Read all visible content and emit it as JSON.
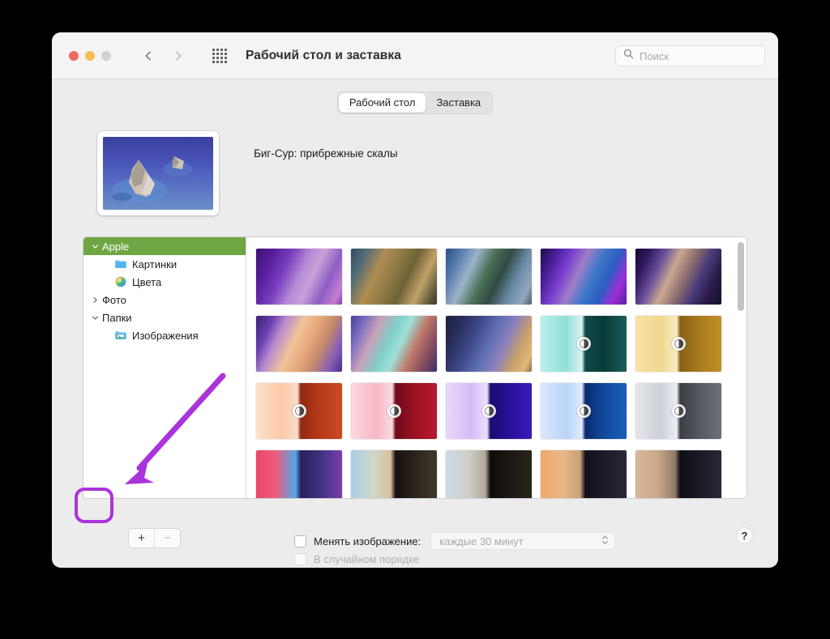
{
  "window": {
    "title": "Рабочий стол и заставка",
    "traffic_lights": [
      "close",
      "minimize",
      "zoom-disabled"
    ],
    "grid_icon": "show-all-grid-icon",
    "back_icon": "chevron-left-icon",
    "forward_icon": "chevron-right-icon"
  },
  "search": {
    "placeholder": "Поиск",
    "icon": "search-icon"
  },
  "tabs": [
    {
      "label": "Рабочий стол",
      "active": true
    },
    {
      "label": "Заставка",
      "active": false
    }
  ],
  "preview": {
    "label": "Биг-Сур: прибрежные скалы",
    "image_name": "big-sur-coastal-rocks"
  },
  "sidebar": {
    "items": [
      {
        "label": "Apple",
        "level": 0,
        "disclosure": "down",
        "icon": null,
        "selected": true
      },
      {
        "label": "Картинки",
        "level": 1,
        "disclosure": null,
        "icon": "blue-folder-icon",
        "selected": false
      },
      {
        "label": "Цвета",
        "level": 1,
        "disclosure": null,
        "icon": "color-wheel-icon",
        "selected": false
      },
      {
        "label": "Фото",
        "level": 0,
        "disclosure": "right",
        "icon": null,
        "selected": false
      },
      {
        "label": "Папки",
        "level": 0,
        "disclosure": "down",
        "icon": null,
        "selected": false
      },
      {
        "label": "Изображения",
        "level": 1,
        "disclosure": null,
        "icon": "pictures-folder-icon",
        "selected": false
      }
    ]
  },
  "wallpapers": {
    "rows": [
      [
        {
          "name": "monterey-graphic-purple",
          "css": "linear-gradient(115deg,#3c0f73 0%,#5a1f9e 18%,#7a3fc0 34%,#b58ad6 50%,#c9a0d8 62%,#8c5ec4 78%,#c77fd0 92%,#7b3fb5 100%)",
          "dynamic": false
        },
        {
          "name": "big-sur-day-landscape",
          "css": "linear-gradient(115deg,#2f4a63 0%,#4f6a77 14%,#b08c52 32%,#8d7a45 48%,#6e6236 62%,#c0a268 78%,#5f5a3c 92%,#3d3a28 100%)",
          "dynamic": false
        },
        {
          "name": "catalina-coast",
          "css": "linear-gradient(115deg,#2a4f84 0%,#5d7fb0 16%,#9cb4c9 30%,#4c6f54 46%,#2f4a45 60%,#6b8aa6 76%,#93a8bf 90%,#4a5d6e 100%)",
          "dynamic": false
        },
        {
          "name": "monterey-violet-cliffs",
          "css": "linear-gradient(115deg,#1b0b44 0%,#4a1f9c 16%,#7a3fd0 30%,#9f7ec8 44%,#3f78c8 58%,#2a5fbf 72%,#9b2fd8 86%,#5a1f9e 100%)",
          "dynamic": false
        },
        {
          "name": "monterey-dark-canyon",
          "css": "linear-gradient(115deg,#120a2e 0%,#2f1b5e 14%,#6a4f9c 28%,#c9a98f 42%,#8f6f6f 56%,#4a3b7a 70%,#2a1a48 84%,#14102c 100%)",
          "dynamic": false
        }
      ],
      [
        {
          "name": "monterey-desert-dunes",
          "css": "linear-gradient(115deg,#3a1f6e 0%,#6a3fb0 16%,#b88ad0 28%,#f0c49a 44%,#e8a87c 58%,#c48a6a 72%,#8a5fb8 86%,#4a2f88 100%)",
          "dynamic": false
        },
        {
          "name": "big-sur-illustrated",
          "css": "linear-gradient(115deg,#4a3f9c 0%,#7a6fc0 14%,#c9a0b8 28%,#7fd0c8 44%,#9fe0d8 56%,#c07a6a 70%,#8a4f5f 84%,#3a2f6e 100%)",
          "dynamic": false
        },
        {
          "name": "monterey-night-gradient",
          "css": "linear-gradient(115deg,#1c1f3e 0%,#2a2f5e 18%,#3f4a8c 34%,#5f6fb0 50%,#8a7fc0 64%,#c9a06a 80%,#e0b87a 92%,#8a6f4a 100%)",
          "dynamic": false
        },
        {
          "name": "imac-green-dynamic",
          "css": "linear-gradient(90deg,#b8f0ea 0%,#8fe0d8 30%,#d8f4f0 48%,#0e4a48 52%,#0a3a38 74%,#1a5f5c 100%)",
          "dynamic": true
        },
        {
          "name": "imac-yellow-dynamic",
          "css": "linear-gradient(90deg,#f7e2a8 0%,#f0d88f 30%,#f9ecc4 48%,#8a5f14 52%,#a87a1f 74%,#c08f28 100%)",
          "dynamic": true
        }
      ],
      [
        {
          "name": "imac-orange-dynamic",
          "css": "linear-gradient(90deg,#fde0cc 0%,#fbc9a8 30%,#fddcc8 48%,#8f2a12 52%,#b83a18 74%,#c94a22 100%)",
          "dynamic": true
        },
        {
          "name": "imac-red-dynamic",
          "css": "linear-gradient(90deg,#fbd8de 0%,#f7b8c4 30%,#fadbe2 48%,#6e0a18 52%,#9c1024 74%,#b81a30 100%)",
          "dynamic": true
        },
        {
          "name": "imac-purple-dynamic",
          "css": "linear-gradient(90deg,#e8d8fb 0%,#d4bcf7 30%,#ece0fd 48%,#1c0a6e 52%,#2a109c 74%,#3a1ab8 100%)",
          "dynamic": true
        },
        {
          "name": "imac-blue-dynamic",
          "css": "linear-gradient(90deg,#dbe8fb 0%,#b8d4f7 30%,#e0ecfd 48%,#0a2a6e 52%,#104a9c 74%,#1a5fb8 100%)",
          "dynamic": true
        },
        {
          "name": "imac-silver-dynamic",
          "css": "linear-gradient(90deg,#e4e6ea 0%,#ccd0d8 30%,#eceef2 48%,#3a3e44 52%,#55595f 74%,#6e7278 100%)",
          "dynamic": true
        }
      ],
      [
        {
          "name": "big-sur-graphic-sunrise",
          "css": "linear-gradient(90deg,#e8486a 0%,#f05a7a 22%,#4fa8e8 46%,#2a1f5e 52%,#3a2f7a 72%,#7a3fb0 100%)",
          "dynamic": false
        },
        {
          "name": "white-sands-day",
          "css": "linear-gradient(90deg,#a8cfe8 0%,#cfd8c8 26%,#d8c0a0 46%,#14120f 52%,#2a241c 74%,#3f382c 100%)",
          "dynamic": false
        },
        {
          "name": "white-sands-dusk",
          "css": "linear-gradient(90deg,#c9dce8 0%,#cfcfc8 26%,#b0a898 46%,#0e0c0a 52%,#1c1814 74%,#2a241c 100%)",
          "dynamic": false
        },
        {
          "name": "big-sur-dunes-evening",
          "css": "linear-gradient(90deg,#f0a868 0%,#e8b888 26%,#c9a078 46%,#12101a 52%,#1c1a28 74%,#2a2838 100%)",
          "dynamic": false
        },
        {
          "name": "monterey-mountain-night",
          "css": "linear-gradient(90deg,#d8b89a 0%,#c9a888 26%,#8f7a68 46%,#0e0e16 52%,#1a1a24 74%,#282834 100%)",
          "dynamic": false
        }
      ]
    ]
  },
  "bottom": {
    "add_label": "+",
    "remove_label": "−",
    "change_image_label": "Менять изображение:",
    "change_image_checked": false,
    "interval_value": "каждые 30 минут",
    "interval_enabled": false,
    "random_label": "В случайном порядке",
    "random_enabled": false,
    "help_label": "?"
  },
  "annotation": {
    "color": "#aa34db",
    "highlight_target": "add-folder-button",
    "arrow": "points-to-add-button"
  }
}
